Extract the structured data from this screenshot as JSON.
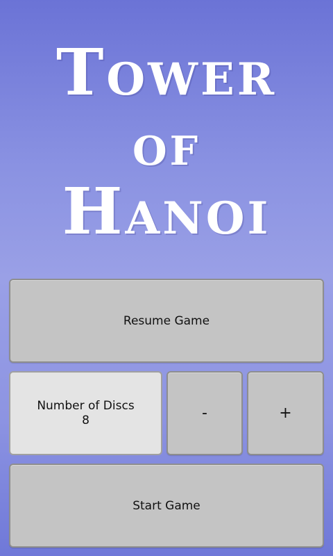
{
  "title": {
    "line1": "Tower",
    "line2": "of",
    "line3": "Hanoi"
  },
  "buttons": {
    "resume_label": "Resume Game",
    "decrease_label": "-",
    "increase_label": "+",
    "start_label": "Start Game"
  },
  "discs": {
    "label": "Number of Discs",
    "value": "8"
  },
  "colors": {
    "background_top": "#6b73d6",
    "background_mid": "#9aa0e6",
    "button": "#c4c4c4",
    "panel": "#e4e4e4",
    "title_text": "#ffffff"
  }
}
